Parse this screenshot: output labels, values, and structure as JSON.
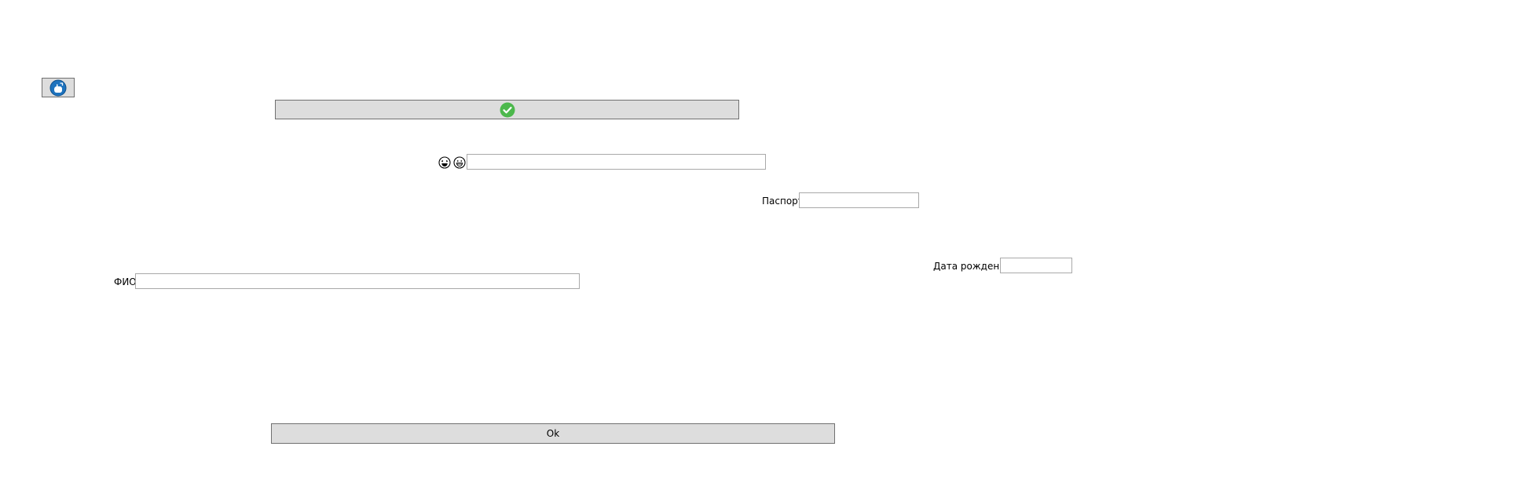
{
  "toolbar": {
    "icon_button_icon": "hand-pointer-icon",
    "confirm_button_icon": "green-checkmark-icon",
    "accent_blue": "#1e73be",
    "check_green": "#4cb84c"
  },
  "search_row": {
    "icons": [
      "laughing-face-icon",
      "grinning-face-icon"
    ],
    "value": ""
  },
  "passport": {
    "label": "Паспорт",
    "value": ""
  },
  "birth_date": {
    "label": "Дата рождения",
    "value": ""
  },
  "full_name": {
    "label": "ФИО",
    "value": ""
  },
  "ok_button": {
    "label": "Ok"
  }
}
